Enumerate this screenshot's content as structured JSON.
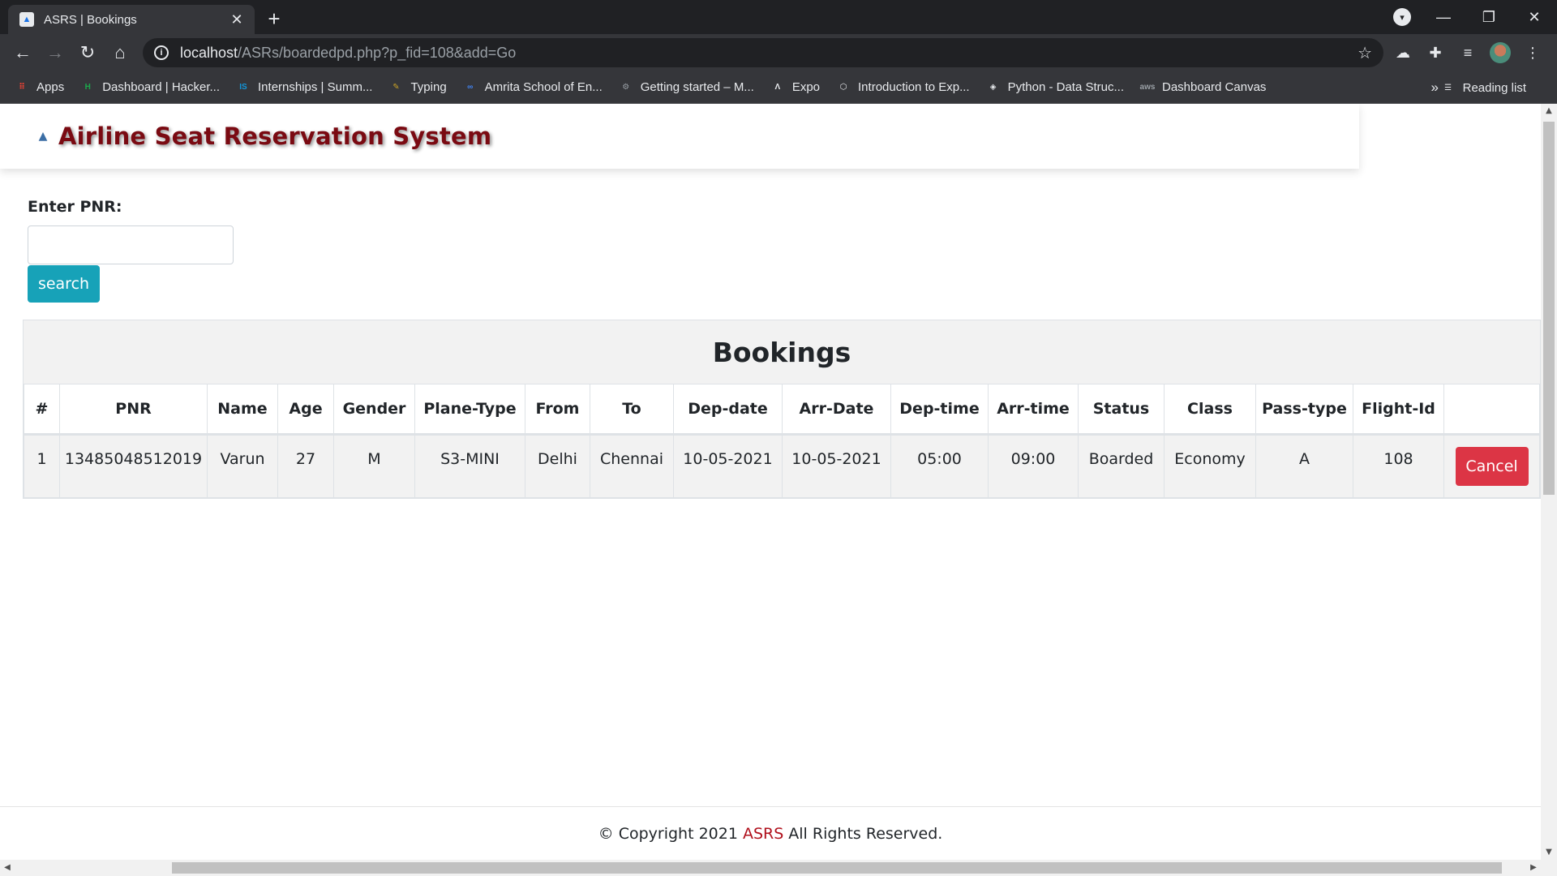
{
  "browser": {
    "tab_title": "ASRS | Bookings",
    "tab_close": "✕",
    "new_tab": "+",
    "url_host": "localhost",
    "url_path": "/ASRs/boardedpd.php?p_fid=108&add=Go",
    "bookmarks": [
      {
        "label": "Apps",
        "icon": "apps-grid-icon",
        "color": "#ea4335"
      },
      {
        "label": "Dashboard | Hacker...",
        "icon": "hackerrank-icon",
        "color": "#1ba94c"
      },
      {
        "label": "Internships | Summ...",
        "icon": "internshala-icon",
        "color": "#1295d8"
      },
      {
        "label": "Typing",
        "icon": "typing-icon",
        "color": "#c9a227"
      },
      {
        "label": "Amrita School of En...",
        "icon": "infinity-icon",
        "color": "#4285f4"
      },
      {
        "label": "Getting started – M...",
        "icon": "gear-icon",
        "color": "#9aa0a6"
      },
      {
        "label": "Expo",
        "icon": "expo-icon",
        "color": "#e8eaed"
      },
      {
        "label": "Introduction to Exp...",
        "icon": "cube-icon",
        "color": "#e8eaed"
      },
      {
        "label": "Python - Data Struc...",
        "icon": "diamond-icon",
        "color": "#e8eaed"
      },
      {
        "label": "Dashboard Canvas",
        "icon": "aws-icon",
        "color": "#9aa0a6"
      }
    ],
    "reading_list": "Reading list",
    "more": "»"
  },
  "site": {
    "brand": "Airline Seat Reservation System",
    "accent_color": "#7a0a12"
  },
  "search": {
    "label": "Enter PNR:",
    "placeholder": "",
    "value": "",
    "button": "search",
    "button_color": "#17a2b8"
  },
  "bookings": {
    "title": "Bookings",
    "columns": [
      "#",
      "PNR",
      "Name",
      "Age",
      "Gender",
      "Plane-Type",
      "From",
      "To",
      "Dep-date",
      "Arr-Date",
      "Dep-time",
      "Arr-time",
      "Status",
      "Class",
      "Pass-type",
      "Flight-Id",
      ""
    ],
    "rows": [
      {
        "num": "1",
        "pnr": "13485048512019",
        "name": "Varun",
        "age": "27",
        "gender": "M",
        "plane_type": "S3-MINI",
        "from": "Delhi",
        "to": "Chennai",
        "dep_date": "10-05-2021",
        "arr_date": "10-05-2021",
        "dep_time": "05:00",
        "arr_time": "09:00",
        "status": "Boarded",
        "class": "Economy",
        "pass_type": "A",
        "flight_id": "108",
        "action": "Cancel"
      }
    ],
    "cancel_color": "#dc3545"
  },
  "footer": {
    "prefix": "© Copyright 2021",
    "brand": "ASRS",
    "suffix": "All Rights Reserved."
  }
}
